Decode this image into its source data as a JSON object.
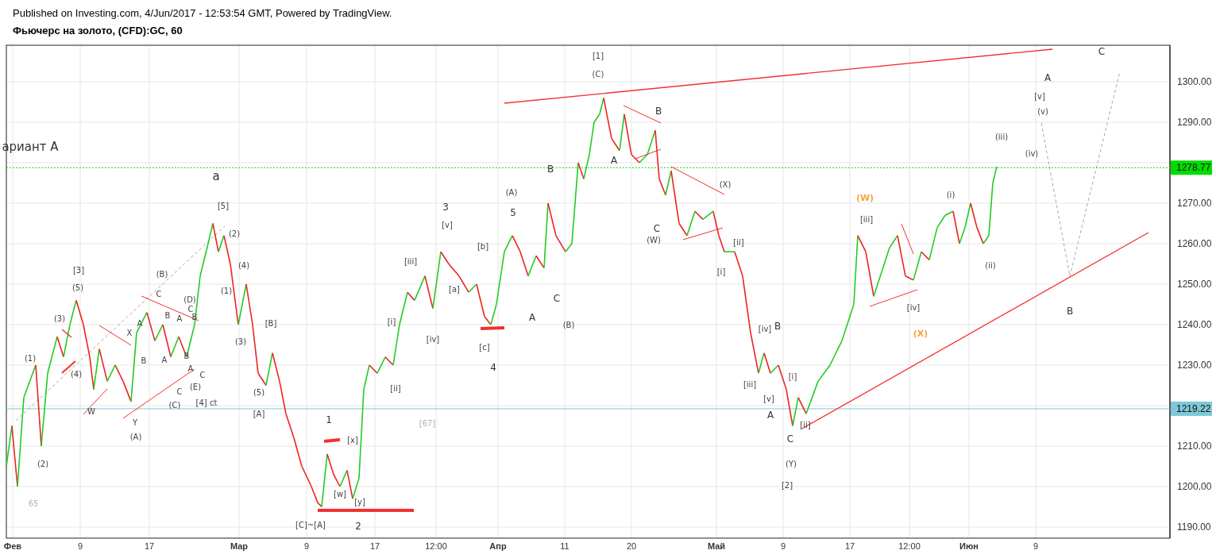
{
  "header": {
    "published": "Published on Investing.com, 4/Jun/2017 - 12:53:54 GMT, Powered by TradingView.",
    "symbol": "Фьючерс на золото, (CFD):GC, 60"
  },
  "chart": {
    "price_ticks": [
      "1300.00",
      "1290.00",
      "1270.00",
      "1260.00",
      "1250.00",
      "1240.00",
      "1230.00",
      "1210.00",
      "1200.00",
      "1190.00"
    ],
    "date_labels": [
      "Фев",
      "9",
      "17",
      "Мар",
      "9",
      "17",
      "12:00",
      "Апр",
      "11",
      "20",
      "Май",
      "9",
      "17",
      "12:00",
      "Июн",
      "9"
    ],
    "price_tags": [
      {
        "text": "1278.77",
        "color": "#00dd00"
      },
      {
        "text": "1219.22",
        "color": "#7ec8d8"
      }
    ],
    "labels": [
      {
        "text": "ариант А",
        "kind": "large"
      },
      {
        "text": "[1]",
        "kind": "small"
      },
      {
        "text": "(C)",
        "kind": "small"
      },
      {
        "text": "B",
        "kind": "letter"
      },
      {
        "text": "A",
        "kind": "letter"
      },
      {
        "text": "C",
        "kind": "letter"
      },
      {
        "text": "(W)",
        "kind": "small"
      },
      {
        "text": "(X)",
        "kind": "small"
      },
      {
        "text": "[ii]",
        "kind": "small"
      },
      {
        "text": "[i]",
        "kind": "small"
      },
      {
        "text": "[iv]",
        "kind": "small"
      },
      {
        "text": "B",
        "kind": "letter"
      },
      {
        "text": "[iii]",
        "kind": "small"
      },
      {
        "text": "[v]",
        "kind": "small"
      },
      {
        "text": "A",
        "kind": "letter"
      },
      {
        "text": "[i]",
        "kind": "small"
      },
      {
        "text": "[ii]",
        "kind": "small"
      },
      {
        "text": "C",
        "kind": "letter"
      },
      {
        "text": "(Y)",
        "kind": "small"
      },
      {
        "text": "[2]",
        "kind": "small"
      },
      {
        "text": "(W)",
        "kind": "accent"
      },
      {
        "text": "[iii]",
        "kind": "small"
      },
      {
        "text": "[iv]",
        "kind": "small"
      },
      {
        "text": "(X)",
        "kind": "accent"
      },
      {
        "text": "(i)",
        "kind": "small"
      },
      {
        "text": "(ii)",
        "kind": "small"
      },
      {
        "text": "(iii)",
        "kind": "small"
      },
      {
        "text": "(iv)",
        "kind": "small"
      },
      {
        "text": "[v]",
        "kind": "small"
      },
      {
        "text": "(v)",
        "kind": "small"
      },
      {
        "text": "A",
        "kind": "letter"
      },
      {
        "text": "C",
        "kind": "letter"
      },
      {
        "text": "B",
        "kind": "letter"
      },
      {
        "text": "3",
        "kind": "letter"
      },
      {
        "text": "[v]",
        "kind": "small"
      },
      {
        "text": "(A)",
        "kind": "small"
      },
      {
        "text": "5",
        "kind": "letter"
      },
      {
        "text": "B",
        "kind": "letter"
      },
      {
        "text": "[iii]",
        "kind": "small"
      },
      {
        "text": "[b]",
        "kind": "small"
      },
      {
        "text": "[a]",
        "kind": "small"
      },
      {
        "text": "[i]",
        "kind": "small"
      },
      {
        "text": "[iv]",
        "kind": "small"
      },
      {
        "text": "[c]",
        "kind": "small"
      },
      {
        "text": "4",
        "kind": "letter"
      },
      {
        "text": "A",
        "kind": "letter"
      },
      {
        "text": "C",
        "kind": "letter"
      },
      {
        "text": "(B)",
        "kind": "small"
      },
      {
        "text": "[ii]",
        "kind": "small"
      },
      {
        "text": "[67]",
        "kind": "faint"
      },
      {
        "text": "1",
        "kind": "letter"
      },
      {
        "text": "[x]",
        "kind": "small"
      },
      {
        "text": "[w]",
        "kind": "small"
      },
      {
        "text": "[y]",
        "kind": "small"
      },
      {
        "text": "[C]~[A]",
        "kind": "small"
      },
      {
        "text": "2",
        "kind": "letter"
      },
      {
        "text": "a",
        "kind": "large"
      },
      {
        "text": "[5]",
        "kind": "small"
      },
      {
        "text": "(2)",
        "kind": "small"
      },
      {
        "text": "(4)",
        "kind": "small"
      },
      {
        "text": "(1)",
        "kind": "small"
      },
      {
        "text": "(3)",
        "kind": "small"
      },
      {
        "text": "[B]",
        "kind": "small"
      },
      {
        "text": "(5)",
        "kind": "small"
      },
      {
        "text": "[A]",
        "kind": "small"
      },
      {
        "text": "[3]",
        "kind": "small"
      },
      {
        "text": "(5)",
        "kind": "small"
      },
      {
        "text": "(3)",
        "kind": "small"
      },
      {
        "text": "(1)",
        "kind": "small"
      },
      {
        "text": "(4)",
        "kind": "small"
      },
      {
        "text": "(2)",
        "kind": "small"
      },
      {
        "text": "(B)",
        "kind": "small"
      },
      {
        "text": "C",
        "kind": "small"
      },
      {
        "text": "(D)",
        "kind": "small"
      },
      {
        "text": "C",
        "kind": "small"
      },
      {
        "text": "X",
        "kind": "small"
      },
      {
        "text": "A",
        "kind": "small"
      },
      {
        "text": "B",
        "kind": "small"
      },
      {
        "text": "A",
        "kind": "small"
      },
      {
        "text": "B",
        "kind": "small"
      },
      {
        "text": "B",
        "kind": "small"
      },
      {
        "text": "A",
        "kind": "small"
      },
      {
        "text": "B",
        "kind": "small"
      },
      {
        "text": "A",
        "kind": "small"
      },
      {
        "text": "C",
        "kind": "small"
      },
      {
        "text": "(E)",
        "kind": "small"
      },
      {
        "text": "C",
        "kind": "small"
      },
      {
        "text": "(C)",
        "kind": "small"
      },
      {
        "text": "[4]  ct",
        "kind": "small"
      },
      {
        "text": "W",
        "kind": "small"
      },
      {
        "text": "Y",
        "kind": "small"
      },
      {
        "text": "(A)",
        "kind": "small"
      },
      {
        "text": "65",
        "kind": "faint"
      }
    ]
  }
}
